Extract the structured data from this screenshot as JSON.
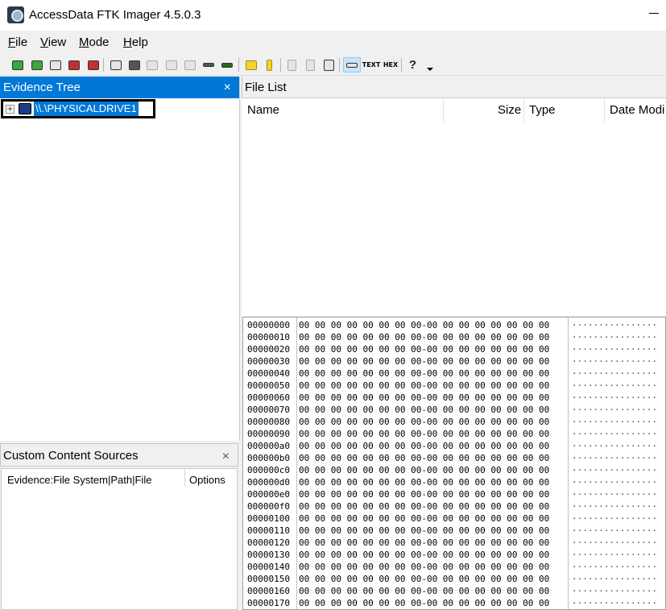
{
  "window": {
    "title": "AccessData FTK Imager 4.5.0.3"
  },
  "menu": [
    "File",
    "View",
    "Mode",
    "Help"
  ],
  "menu_mnemonics": [
    "F",
    "V",
    "M",
    "H"
  ],
  "toolbar": {
    "icons": [
      "add-evidence-icon",
      "add-all-evidence-icon",
      "image-mounting-icon",
      "remove-evidence-icon",
      "remove-all-evidence-icon",
      "create-disk-image-icon",
      "export-disk-image-icon",
      "export-logical-image-icon",
      "add-to-custom-content-icon",
      "create-custom-content-image-icon",
      "decrypt-ad1-icon",
      "obtain-protected-files-icon",
      "detect-efs-icon",
      "export-files-icon",
      "export-file-hash-list-icon",
      "export-directory-listing-icon",
      "verify-drive-image-icon",
      "capture-memory-icon",
      "auto-view-icon",
      "text-view-icon",
      "hex-view-icon",
      "help-icon"
    ],
    "text_label": "TEXT",
    "hex_label": "HEX",
    "help_glyph": "?"
  },
  "evidence_tree": {
    "title": "Evidence Tree",
    "close_glyph": "×",
    "expander_glyph": "+",
    "items": [
      {
        "label": "\\\\.\\PHYSICALDRIVE1",
        "selected": true
      }
    ]
  },
  "custom_content": {
    "title": "Custom Content Sources",
    "close_glyph": "×",
    "columns": [
      "Evidence:File System|Path|File",
      "Options"
    ]
  },
  "file_list": {
    "title": "File List",
    "columns": [
      "Name",
      "Size",
      "Type",
      "Date Modi"
    ]
  },
  "hex_view": {
    "rows": [
      {
        "offset": "00000000",
        "bytes": "00 00 00 00 00 00 00 00-00 00 00 00 00 00 00 00",
        "ascii": "················"
      },
      {
        "offset": "00000010",
        "bytes": "00 00 00 00 00 00 00 00-00 00 00 00 00 00 00 00",
        "ascii": "················"
      },
      {
        "offset": "00000020",
        "bytes": "00 00 00 00 00 00 00 00-00 00 00 00 00 00 00 00",
        "ascii": "················"
      },
      {
        "offset": "00000030",
        "bytes": "00 00 00 00 00 00 00 00-00 00 00 00 00 00 00 00",
        "ascii": "················"
      },
      {
        "offset": "00000040",
        "bytes": "00 00 00 00 00 00 00 00-00 00 00 00 00 00 00 00",
        "ascii": "················"
      },
      {
        "offset": "00000050",
        "bytes": "00 00 00 00 00 00 00 00-00 00 00 00 00 00 00 00",
        "ascii": "················"
      },
      {
        "offset": "00000060",
        "bytes": "00 00 00 00 00 00 00 00-00 00 00 00 00 00 00 00",
        "ascii": "················"
      },
      {
        "offset": "00000070",
        "bytes": "00 00 00 00 00 00 00 00-00 00 00 00 00 00 00 00",
        "ascii": "················"
      },
      {
        "offset": "00000080",
        "bytes": "00 00 00 00 00 00 00 00-00 00 00 00 00 00 00 00",
        "ascii": "················"
      },
      {
        "offset": "00000090",
        "bytes": "00 00 00 00 00 00 00 00-00 00 00 00 00 00 00 00",
        "ascii": "················"
      },
      {
        "offset": "000000a0",
        "bytes": "00 00 00 00 00 00 00 00-00 00 00 00 00 00 00 00",
        "ascii": "················"
      },
      {
        "offset": "000000b0",
        "bytes": "00 00 00 00 00 00 00 00-00 00 00 00 00 00 00 00",
        "ascii": "················"
      },
      {
        "offset": "000000c0",
        "bytes": "00 00 00 00 00 00 00 00-00 00 00 00 00 00 00 00",
        "ascii": "················"
      },
      {
        "offset": "000000d0",
        "bytes": "00 00 00 00 00 00 00 00-00 00 00 00 00 00 00 00",
        "ascii": "················"
      },
      {
        "offset": "000000e0",
        "bytes": "00 00 00 00 00 00 00 00-00 00 00 00 00 00 00 00",
        "ascii": "················"
      },
      {
        "offset": "000000f0",
        "bytes": "00 00 00 00 00 00 00 00-00 00 00 00 00 00 00 00",
        "ascii": "················"
      },
      {
        "offset": "00000100",
        "bytes": "00 00 00 00 00 00 00 00-00 00 00 00 00 00 00 00",
        "ascii": "················"
      },
      {
        "offset": "00000110",
        "bytes": "00 00 00 00 00 00 00 00-00 00 00 00 00 00 00 00",
        "ascii": "················"
      },
      {
        "offset": "00000120",
        "bytes": "00 00 00 00 00 00 00 00-00 00 00 00 00 00 00 00",
        "ascii": "················"
      },
      {
        "offset": "00000130",
        "bytes": "00 00 00 00 00 00 00 00-00 00 00 00 00 00 00 00",
        "ascii": "················"
      },
      {
        "offset": "00000140",
        "bytes": "00 00 00 00 00 00 00 00-00 00 00 00 00 00 00 00",
        "ascii": "················"
      },
      {
        "offset": "00000150",
        "bytes": "00 00 00 00 00 00 00 00-00 00 00 00 00 00 00 00",
        "ascii": "················"
      },
      {
        "offset": "00000160",
        "bytes": "00 00 00 00 00 00 00 00-00 00 00 00 00 00 00 00",
        "ascii": "················"
      },
      {
        "offset": "00000170",
        "bytes": "00 00 00 00 00 00 00 00-00 00 00 00 00 00 00 00",
        "ascii": "················"
      }
    ]
  },
  "colors": {
    "accent": "#0078d7",
    "selection_border": "#000000"
  }
}
